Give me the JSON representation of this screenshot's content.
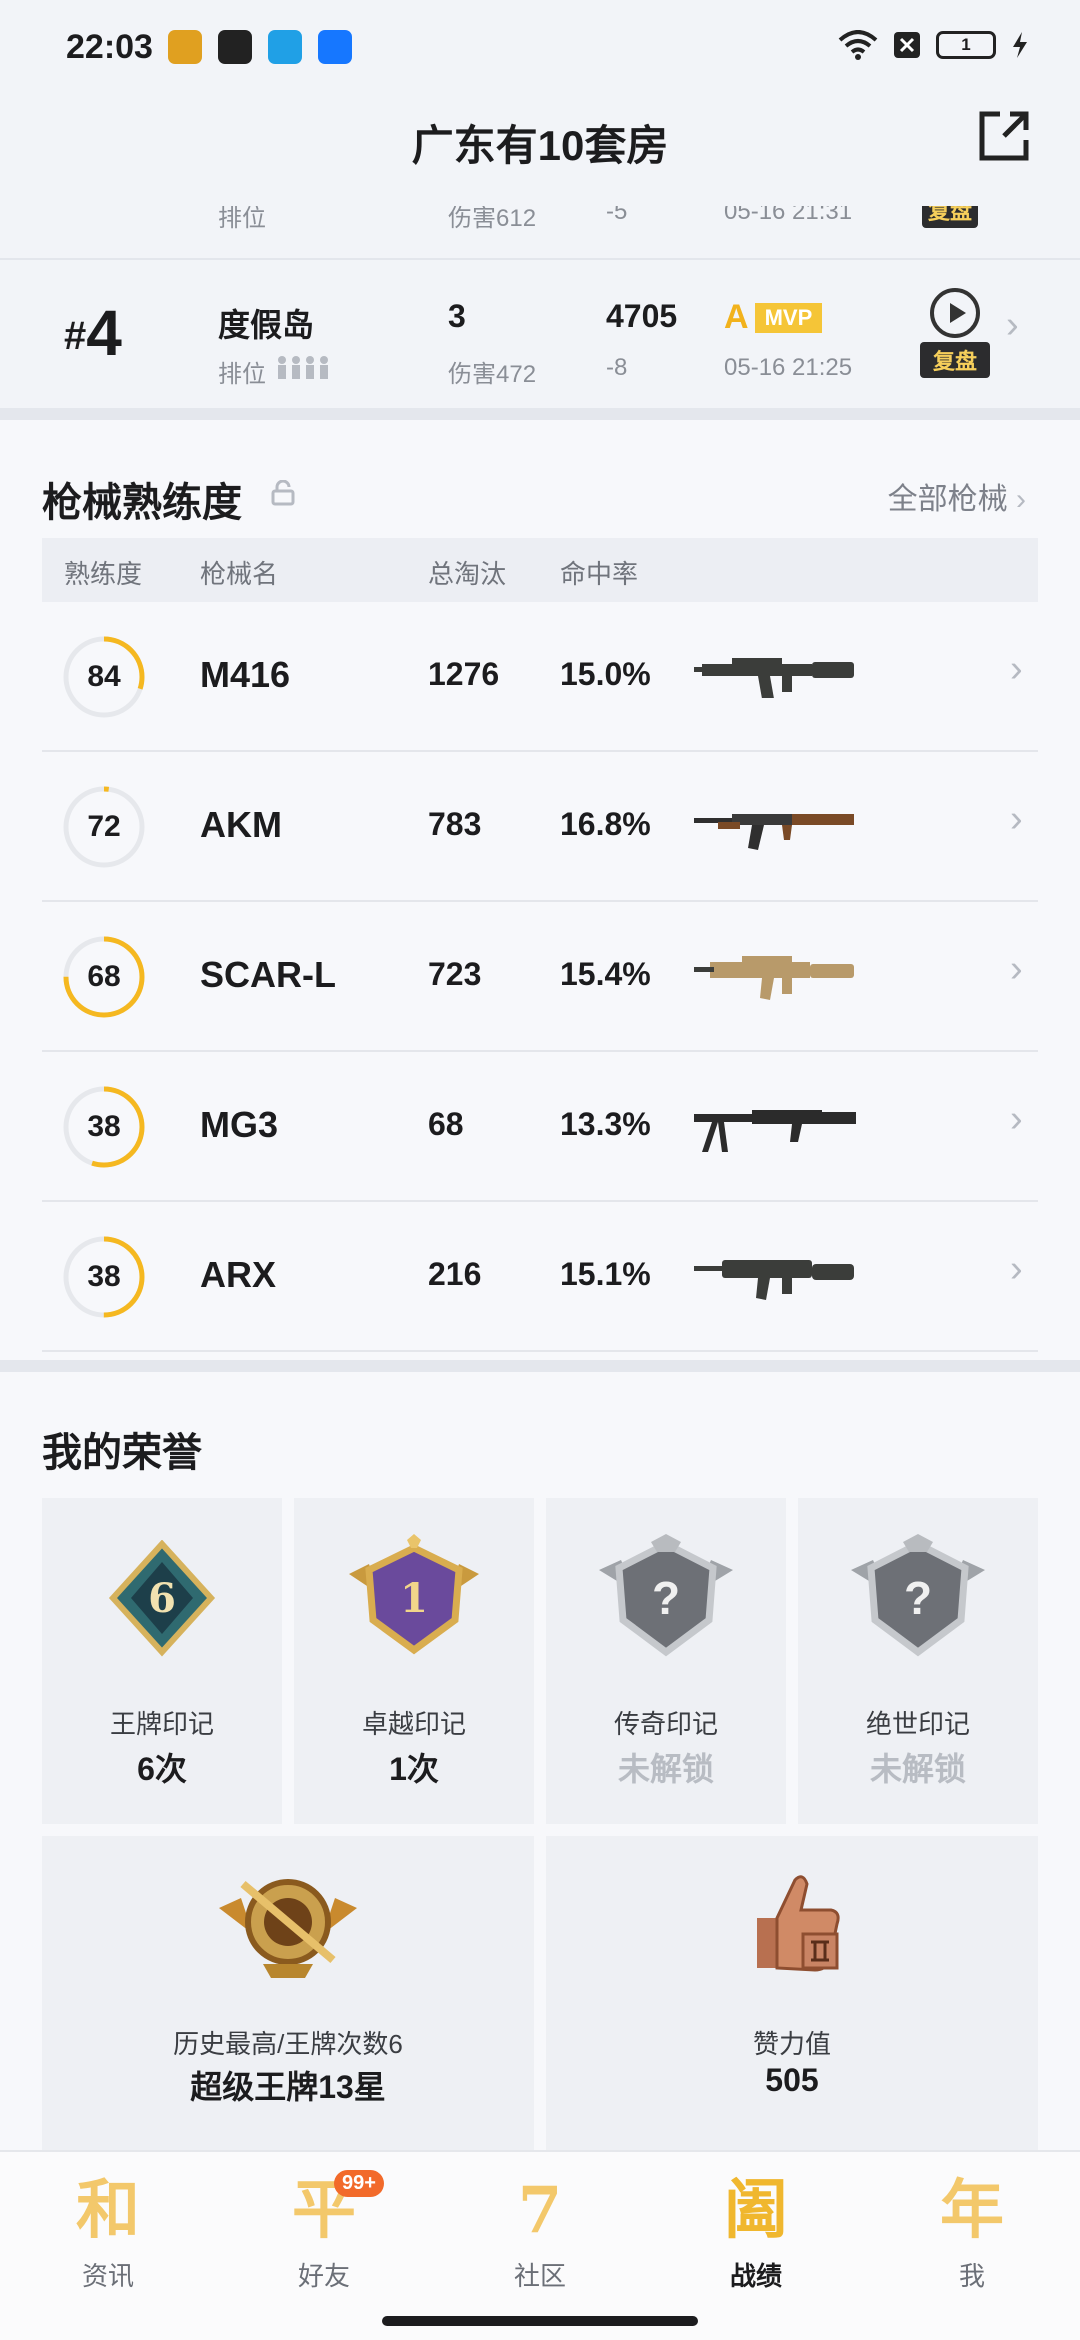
{
  "status": {
    "time": "22:03",
    "battery": "1"
  },
  "header": {
    "title": "广东有10套房"
  },
  "prev_match": {
    "mode": "排位",
    "damage": "伤害612",
    "score_change": "-5",
    "time": "05-16 21:31",
    "replay": "复盘"
  },
  "match": {
    "rank_prefix": "#",
    "rank": "4",
    "map": "度假岛",
    "mode": "排位",
    "kills": "3",
    "damage": "伤害472",
    "score": "4705",
    "score_change": "-8",
    "grade": "A",
    "mvp": "MVP",
    "time": "05-16 21:25",
    "replay": "复盘"
  },
  "weapons": {
    "title": "枪械熟练度",
    "all_link": "全部枪械",
    "columns": [
      "熟练度",
      "枪械名",
      "总淘汰",
      "命中率"
    ],
    "rows": [
      {
        "mastery": "84",
        "mastery_fraction": 0.3,
        "name": "M416",
        "kills": "1276",
        "accuracy": "15.0%"
      },
      {
        "mastery": "72",
        "mastery_fraction": 0.02,
        "name": "AKM",
        "kills": "783",
        "accuracy": "16.8%"
      },
      {
        "mastery": "68",
        "mastery_fraction": 0.75,
        "name": "SCAR-L",
        "kills": "723",
        "accuracy": "15.4%"
      },
      {
        "mastery": "38",
        "mastery_fraction": 0.55,
        "name": "MG3",
        "kills": "68",
        "accuracy": "13.3%"
      },
      {
        "mastery": "38",
        "mastery_fraction": 0.5,
        "name": "ARX",
        "kills": "216",
        "accuracy": "15.1%"
      }
    ]
  },
  "honors": {
    "title": "我的荣誉",
    "items": [
      {
        "label": "王牌印记",
        "value": "6次",
        "badge_number": "6"
      },
      {
        "label": "卓越印记",
        "value": "1次",
        "badge_number": "1"
      },
      {
        "label": "传奇印记",
        "value": "未解锁",
        "badge_number": "?"
      },
      {
        "label": "绝世印记",
        "value": "未解锁",
        "badge_number": "?"
      }
    ],
    "peak": {
      "label": "历史最高/王牌次数6",
      "value": "超级王牌13星"
    },
    "likes": {
      "label": "赞力值",
      "value": "505"
    }
  },
  "nav": {
    "items": [
      {
        "icon": "和",
        "label": "资讯"
      },
      {
        "icon": "平",
        "label": "好友",
        "badge": "99+"
      },
      {
        "icon": "7",
        "label": "社区"
      },
      {
        "icon": "阖",
        "label": "战绩"
      },
      {
        "icon": "年",
        "label": "我"
      }
    ]
  },
  "colors": {
    "accent": "#f5b820",
    "ring_track": "#e6e8ec",
    "bg": "#f2f4f8"
  }
}
